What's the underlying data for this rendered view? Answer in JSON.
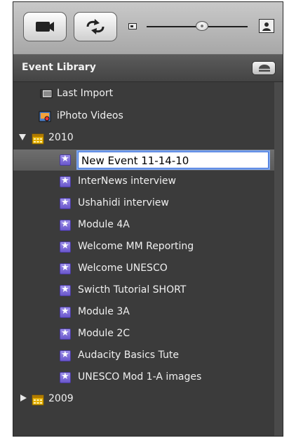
{
  "window": {
    "library_title": "Event Library"
  },
  "colors": {
    "star_icon": "#7b69d6",
    "calendar_icon": "#e6b000",
    "selection_outline": "#3d6fd8"
  },
  "icons": {
    "toolbar_left": "camera-icon",
    "toolbar_right": "swap-arrows-icon",
    "slider_min": "small-thumbnail-icon",
    "slider_max": "large-thumbnail-icon",
    "eject": "eject-icon",
    "last_import": "film-strip-icon",
    "iphoto": "iphoto-icon",
    "year": "calendar-icon",
    "event": "star-icon"
  },
  "thumbnail_slider": {
    "value_fraction": 0.55
  },
  "library": {
    "last_import": "Last Import",
    "iphoto_videos": "iPhoto Videos",
    "years": [
      {
        "label": "2010",
        "expanded": true,
        "editing_event": "New Event 11-14-10",
        "events": [
          "InterNews interview",
          "Ushahidi interview",
          "Module 4A",
          "Welcome MM Reporting",
          "Welcome UNESCO",
          "Swicth Tutorial SHORT",
          "Module 3A",
          "Module 2C",
          "Audacity Basics Tute",
          "UNESCO Mod 1-A images"
        ]
      },
      {
        "label": "2009",
        "expanded": false
      }
    ]
  }
}
